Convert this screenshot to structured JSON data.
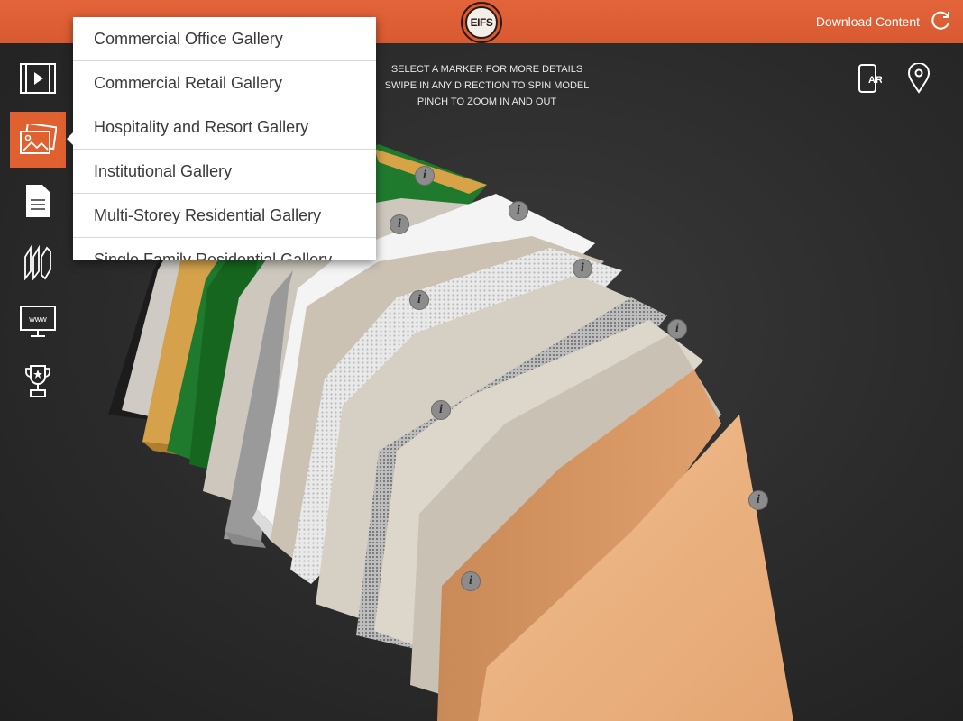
{
  "header": {
    "logo_text": "EIFS",
    "download_label": "Download Content",
    "refresh_icon": "refresh-icon"
  },
  "sidebar": {
    "items": [
      {
        "name": "video-icon",
        "active": false
      },
      {
        "name": "gallery-icon",
        "active": true
      },
      {
        "name": "document-icon",
        "active": false
      },
      {
        "name": "layers-icon",
        "active": false
      },
      {
        "name": "website-icon",
        "active": false
      },
      {
        "name": "award-icon",
        "active": false
      }
    ]
  },
  "instructions": {
    "line1": "Select a marker for more details",
    "line2": "Swipe in any direction to spin model",
    "line3": "Pinch to zoom in and out"
  },
  "top_right": {
    "ar_icon": "ar-phone-icon",
    "location_icon": "location-pin-icon"
  },
  "menu": {
    "items": [
      "Commercial Office Gallery",
      "Commercial Retail Gallery",
      "Hospitality and Resort Gallery",
      "Institutional Gallery",
      "Multi-Storey Residential Gallery",
      "Single Family Residential Gallery"
    ]
  },
  "markers": {
    "label": "i",
    "count": 9
  },
  "colors": {
    "accent": "#e1602f",
    "topbar": "#d95a30",
    "background": "#2b2b2b",
    "finish_coat": "#eab27f"
  }
}
